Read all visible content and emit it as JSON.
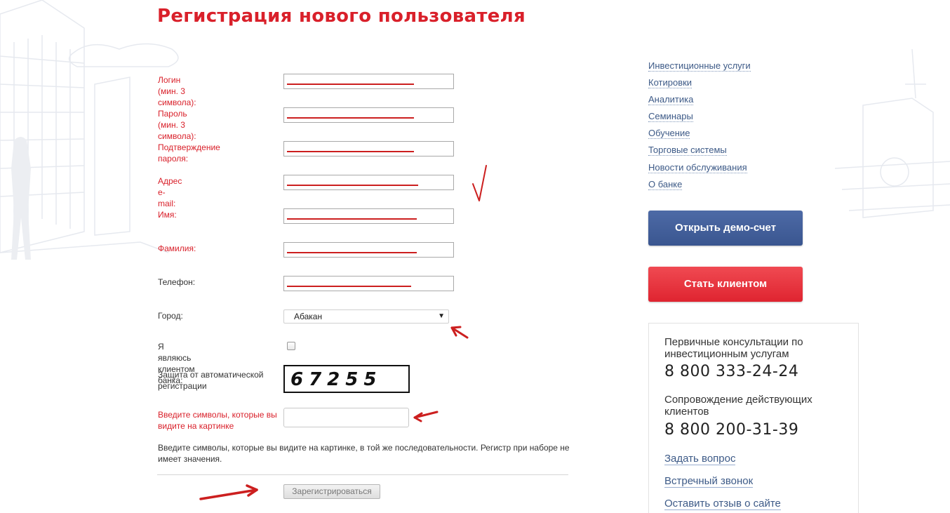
{
  "page": {
    "title": "Регистрация нового пользователя"
  },
  "form": {
    "fields": [
      {
        "label": "Логин (мин. 3 символа):",
        "required": true,
        "fill": 181
      },
      {
        "label": "Пароль (мин. 3 символа):",
        "required": true,
        "fill": 181
      },
      {
        "label": "Подтверждение пароля:",
        "required": true,
        "fill": 181
      },
      {
        "label": "Адрес e-mail:",
        "required": true,
        "fill": 187
      },
      {
        "label": "Имя:",
        "required": true,
        "fill": 185
      },
      {
        "label": "Фамилия:",
        "required": true,
        "fill": 185
      },
      {
        "label": "Телефон:",
        "required": false,
        "fill": 177
      }
    ],
    "city": {
      "label": "Город:",
      "value": "Абакан"
    },
    "bank_client": {
      "label": "Я являюсь клиентом банка:",
      "checked": false
    },
    "captcha": {
      "label": "Защита от автоматической регистрации",
      "digits": "67255"
    },
    "captcha_input": {
      "label": "Введите символы, которые вы видите на картинке",
      "value": ""
    },
    "hint": "Введите символы, которые вы видите на картинке, в той же последовательности. Регистр при наборе не имеет значения.",
    "submit_label": "Зарегистрироваться"
  },
  "sidebar": {
    "nav": [
      "Инвестиционные услуги",
      "Котировки",
      "Аналитика",
      "Семинары",
      "Обучение",
      "Торговые системы",
      "Новости обслуживания",
      "О банке"
    ],
    "demo_button": "Открыть демо-счет",
    "client_button": "Стать клиентом",
    "contacts": {
      "consult_text": "Первичные консультации по инвестиционным услугам",
      "consult_phone": "8 800 333-24-24",
      "support_text": "Сопровождение действующих клиентов",
      "support_phone": "8 800 200-31-39",
      "links": [
        "Задать вопрос",
        "Встречный звонок",
        "Оставить отзыв о сайте"
      ]
    }
  },
  "colors": {
    "accent_red": "#d9202a",
    "brand_blue": "#3a5690",
    "annotation_red": "#cc1f1f"
  }
}
